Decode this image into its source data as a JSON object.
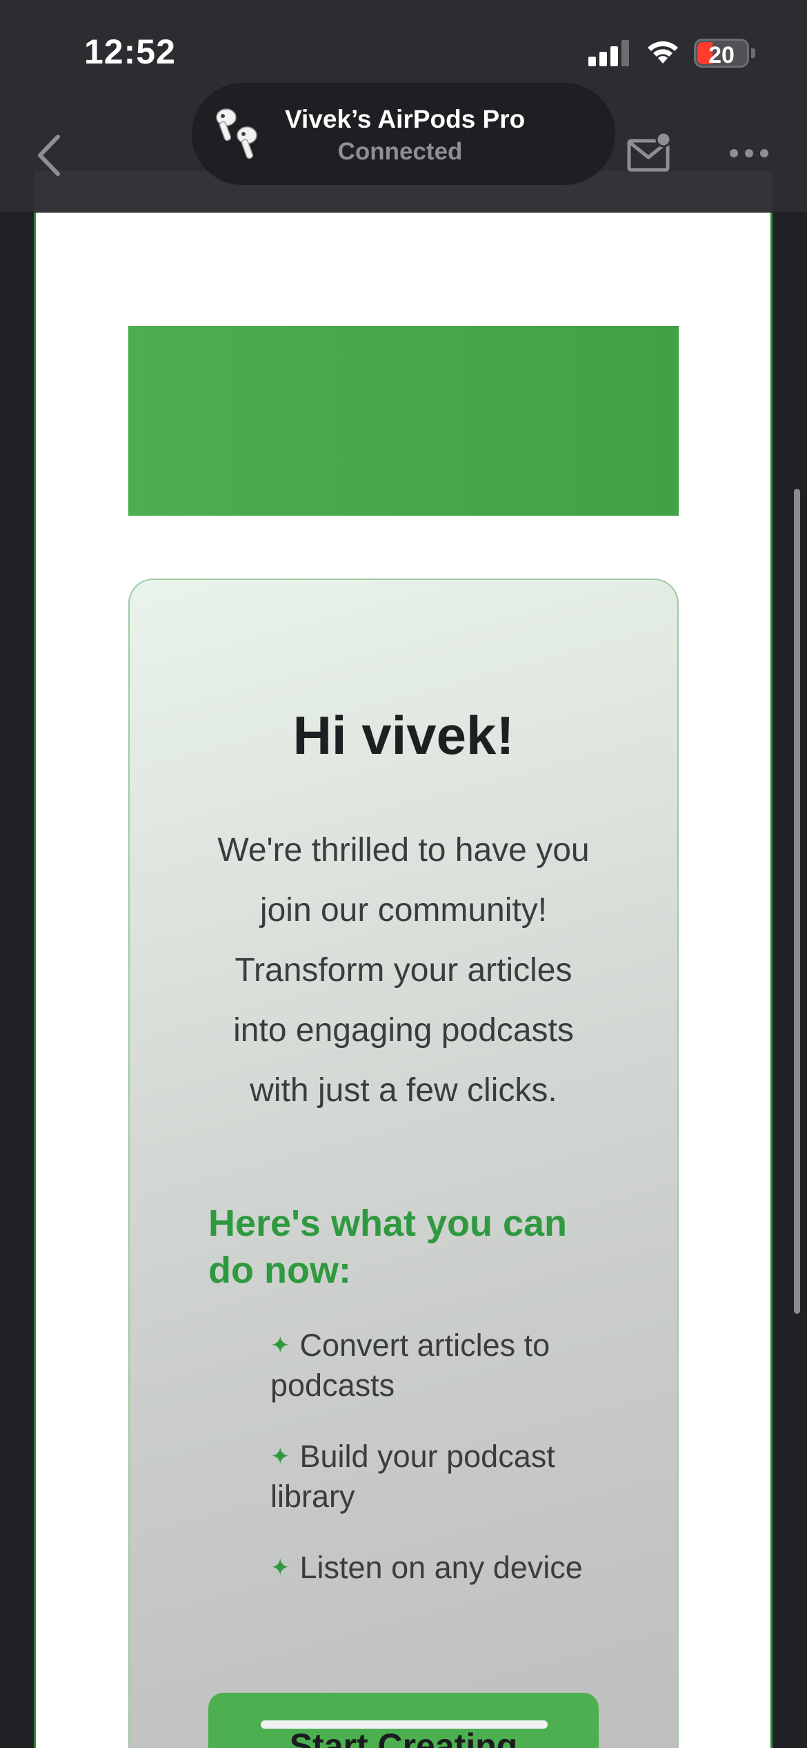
{
  "status_bar": {
    "time": "12:52",
    "battery_level": "20",
    "battery_color": "#ff3b30"
  },
  "toolbar": {
    "back_icon": "chevron-left-icon",
    "mail_icon": "mail-badge-icon",
    "more_icon": "ellipsis-icon"
  },
  "airpods_popup": {
    "device_name": "Vivek’s AirPods Pro",
    "status": "Connected"
  },
  "email": {
    "banner_color": "#4caf50",
    "greeting": "Hi vivek!",
    "intro": "We're thrilled to have you join our community! Transform your articles into engaging podcasts with just a few clicks.",
    "subheading": "Here's what you can do now:",
    "feature_bullet": "✦",
    "features": [
      "Convert articles to podcasts",
      "Build your podcast library",
      "Listen on any device"
    ],
    "cta_label": "Start Creating",
    "accent_color": "#2f9940"
  }
}
